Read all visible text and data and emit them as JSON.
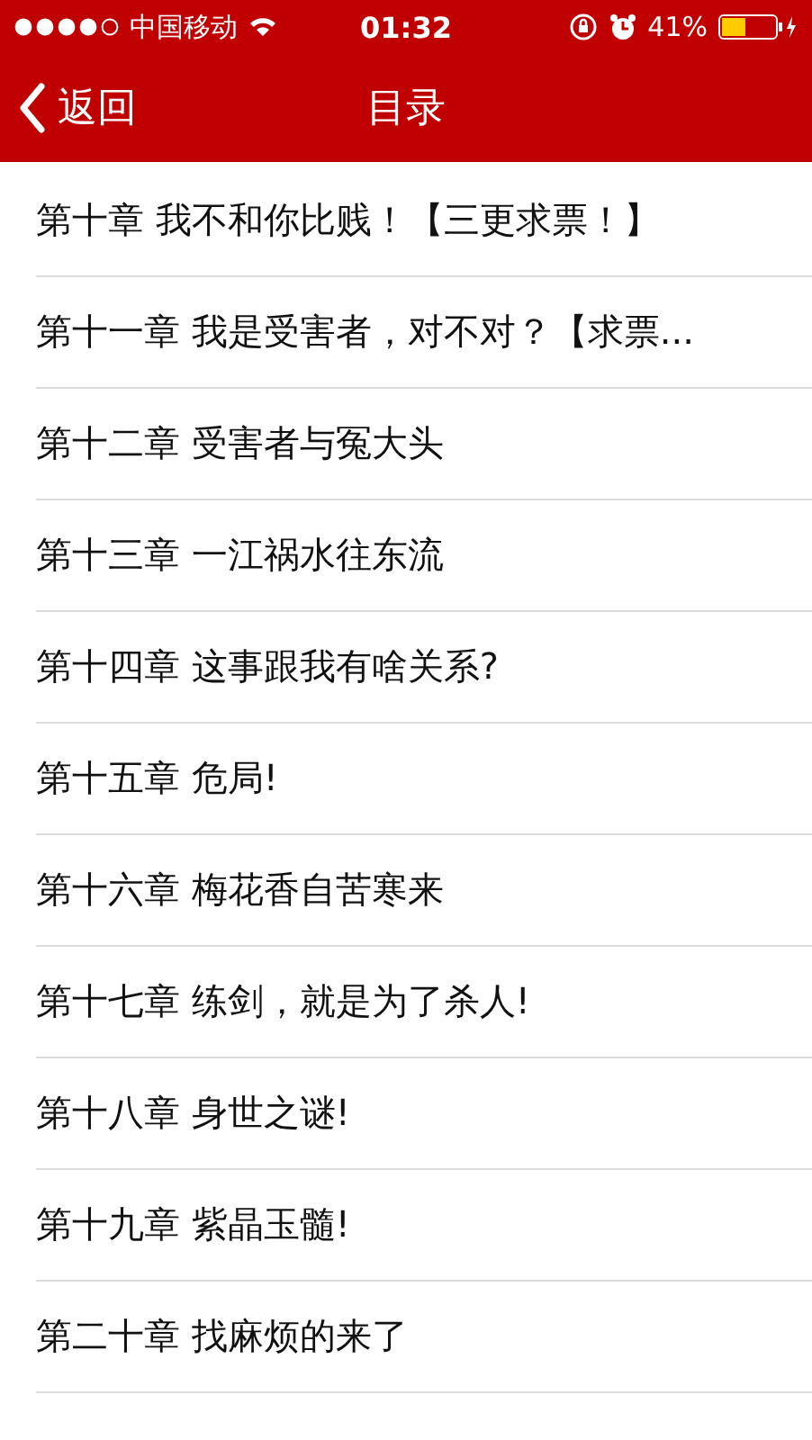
{
  "status_bar": {
    "carrier": "中国移动",
    "time": "01:32",
    "battery": "41%"
  },
  "nav_bar": {
    "back": "返回",
    "title": "目录"
  },
  "chapters": [
    "第十章 我不和你比贱！【三更求票！】",
    "第十一章 我是受害者，对不对？【求票...",
    "第十二章 受害者与冤大头",
    "第十三章 一江祸水往东流",
    "第十四章 这事跟我有啥关系?",
    "第十五章 危局!",
    "第十六章 梅花香自苦寒来",
    "第十七章 练剑，就是为了杀人!",
    "第十八章 身世之谜!",
    "第十九章 紫晶玉髓!",
    "第二十章 找麻烦的来了"
  ]
}
